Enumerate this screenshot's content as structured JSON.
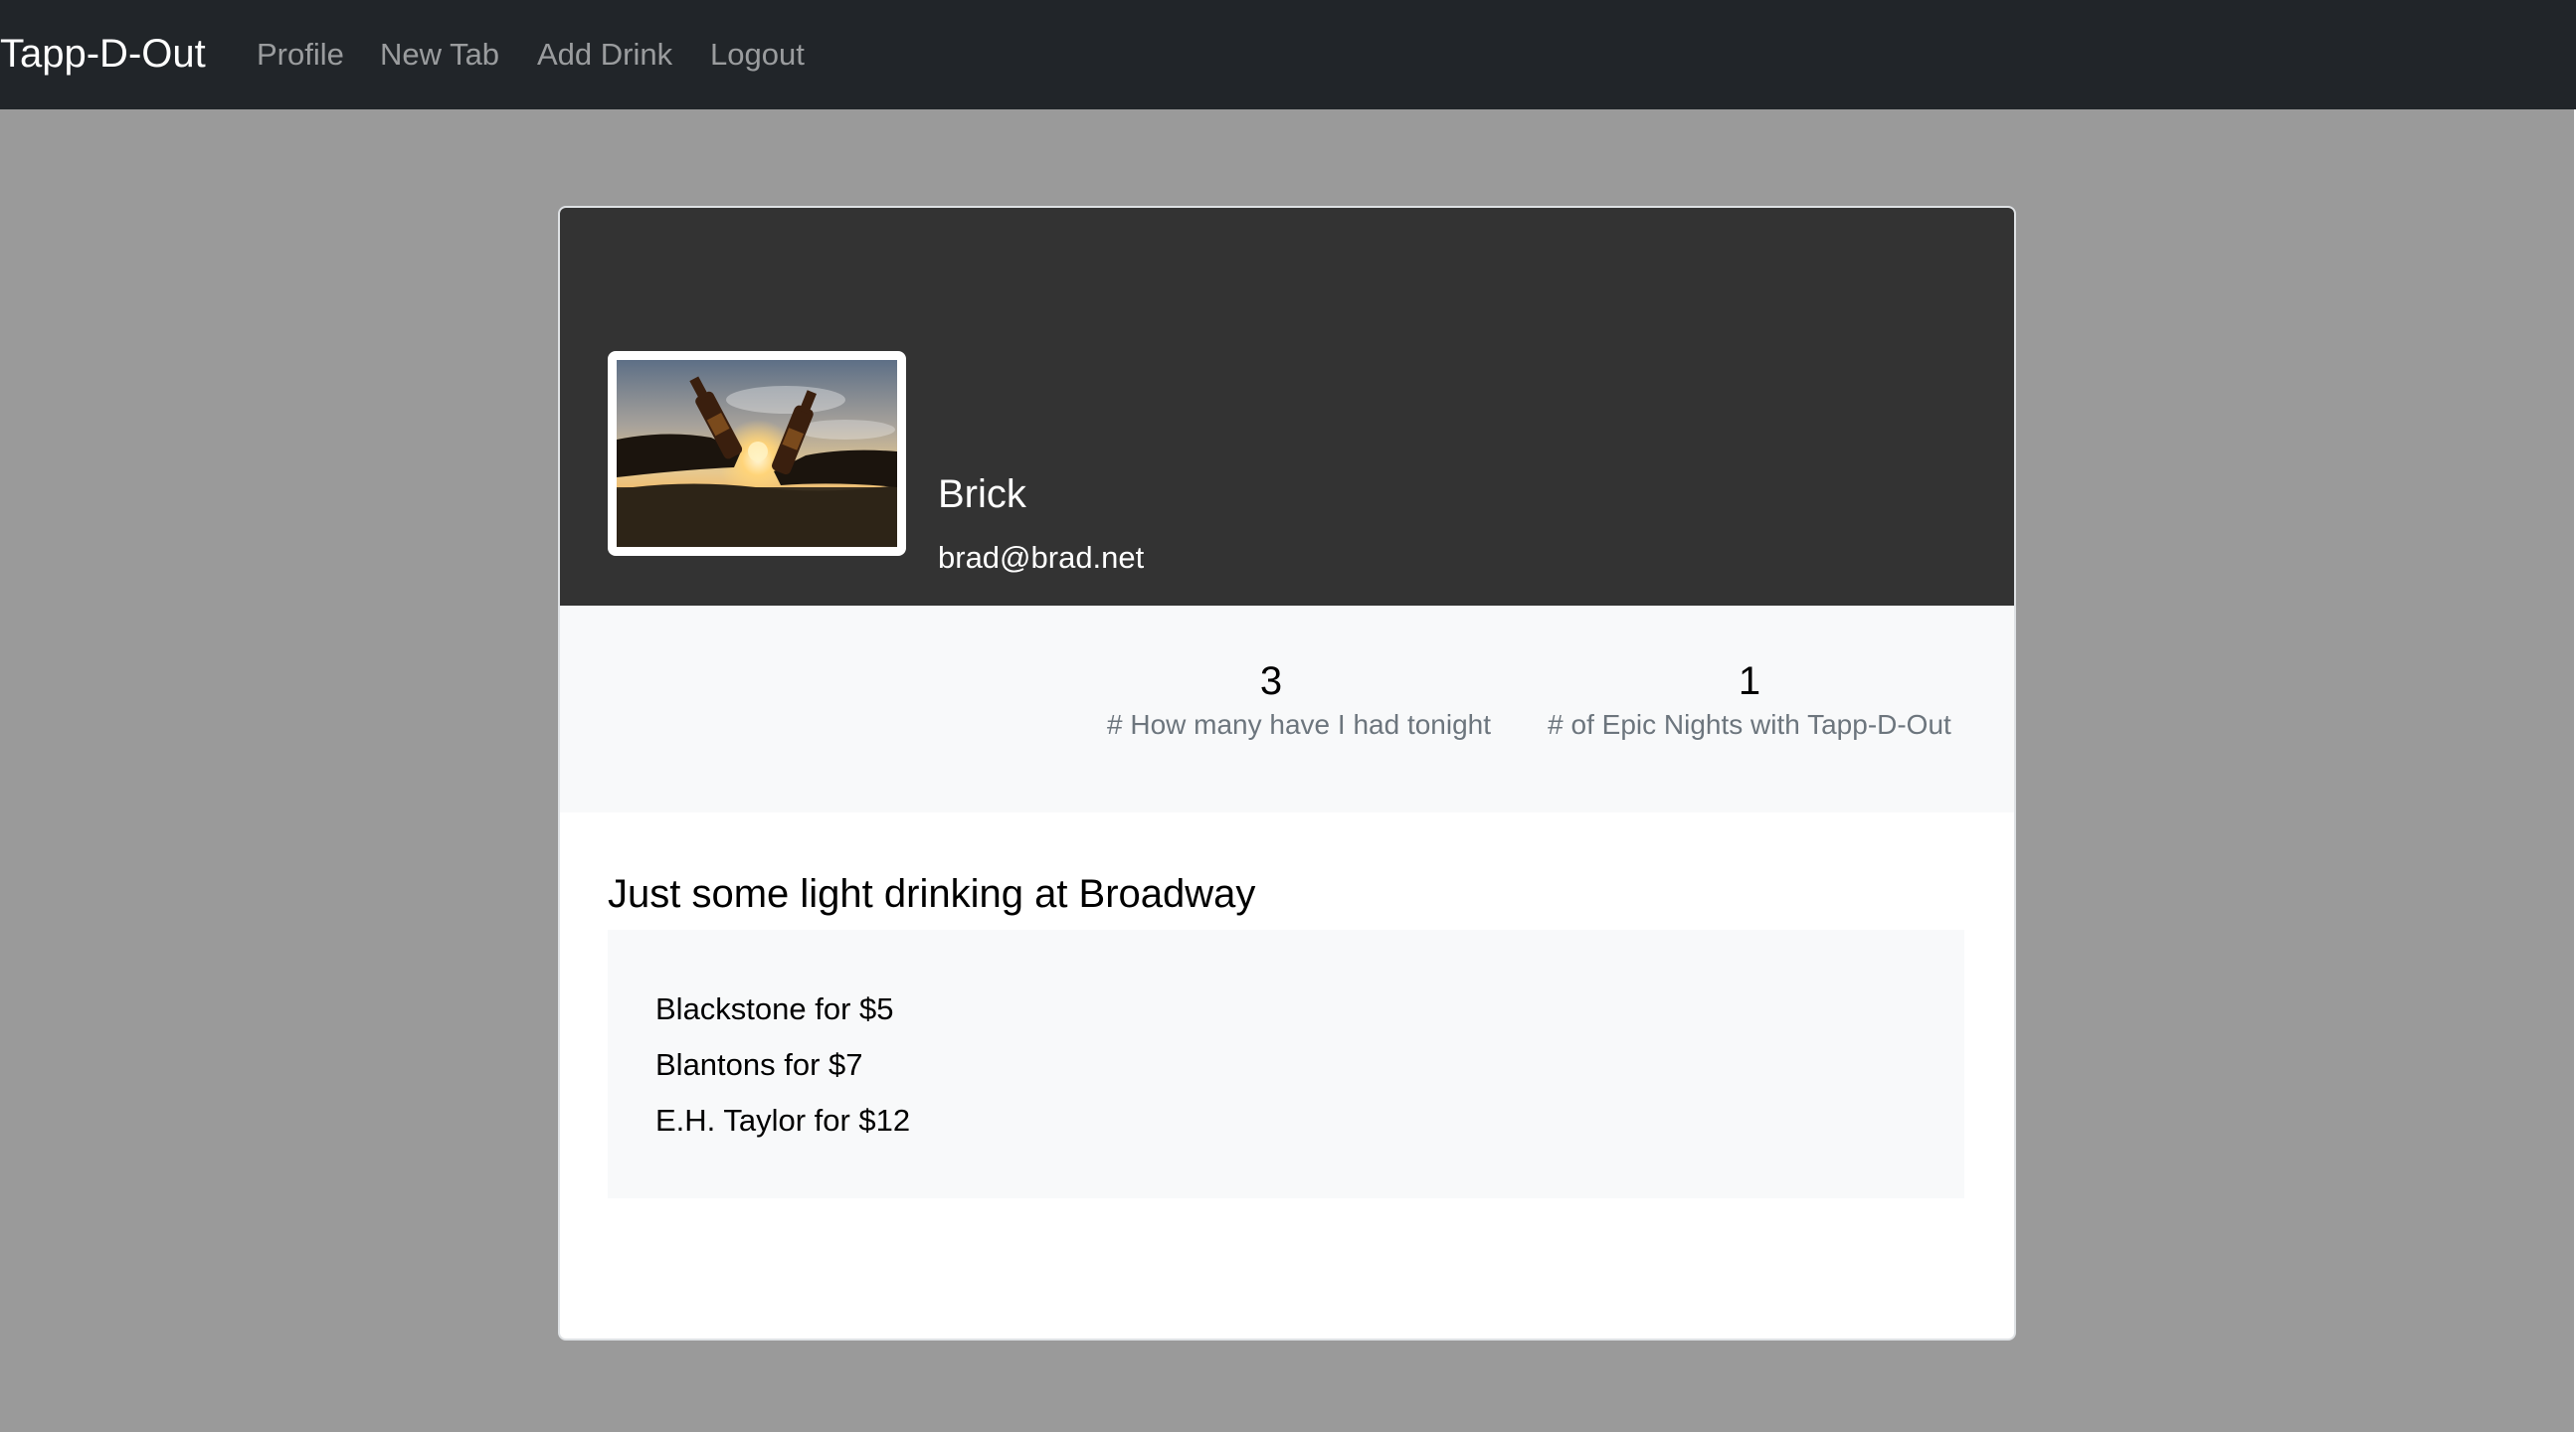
{
  "navbar": {
    "brand": "Tapp-D-Out",
    "links": [
      "Profile",
      "New Tab",
      "Add Drink",
      "Logout"
    ]
  },
  "profile": {
    "name": "Brick",
    "email": "brad@brad.net",
    "avatar_alt": "beer-toast-photo"
  },
  "stats": [
    {
      "value": "3",
      "label": "# How many have I had tonight"
    },
    {
      "value": "1",
      "label": "# of Epic Nights with Tapp-D-Out"
    }
  ],
  "session": {
    "title": "Just some light drinking at Broadway",
    "drinks": [
      "Blackstone for $5",
      "Blantons for $7",
      "E.H. Taylor for $12"
    ]
  },
  "colors": {
    "navbar_bg": "#212529",
    "page_bg": "#9a9a9a",
    "card_header_bg": "#333333",
    "stats_bg": "#f8f9fa",
    "muted_text": "#6c757d"
  }
}
